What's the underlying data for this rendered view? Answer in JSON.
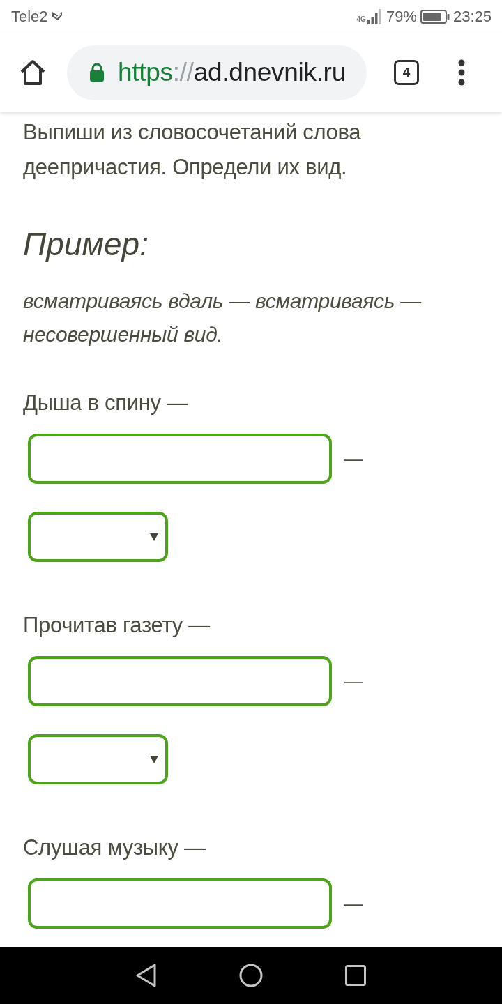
{
  "status_bar": {
    "carrier": "Tele2",
    "network": "4G",
    "battery": "79%",
    "time": "23:25"
  },
  "browser": {
    "secure": true,
    "address": {
      "scheme": "https",
      "separator": "://",
      "host": "ad.dnevnik.ru"
    },
    "tab_count": "4"
  },
  "task": {
    "instruction": "Выпиши из словосочетаний слова деепричастия. Определи их вид.",
    "example_heading": "Пример:",
    "example": "всматриваясь вдаль — всматриваясь — несовершенный вид."
  },
  "exercises": [
    {
      "prompt": "Дыша в спину —",
      "fields": [
        {
          "kind": "input",
          "separator": "—"
        },
        {
          "kind": "select"
        }
      ]
    },
    {
      "prompt": "Прочитав газету —",
      "fields": [
        {
          "kind": "input",
          "separator": "—"
        },
        {
          "kind": "select"
        }
      ]
    },
    {
      "prompt": "Слушая музыку —",
      "fields": [
        {
          "kind": "input",
          "separator": "—"
        }
      ]
    }
  ]
}
